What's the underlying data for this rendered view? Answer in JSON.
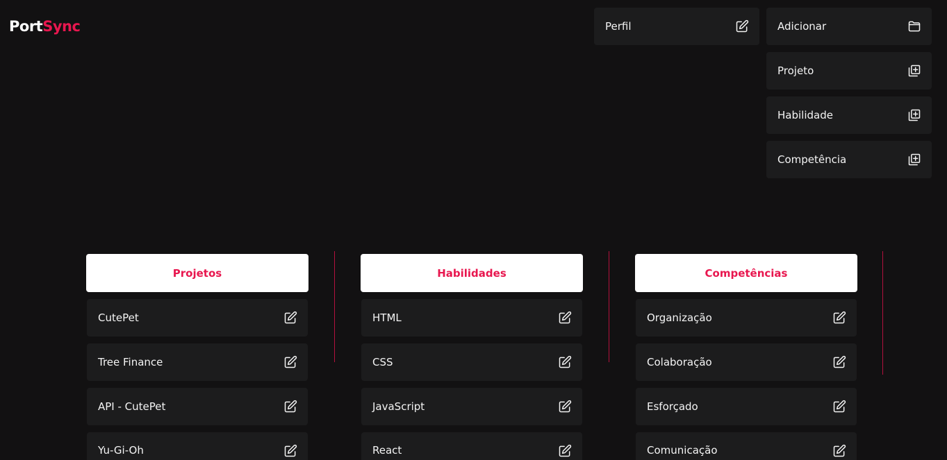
{
  "logo": {
    "part1": "Port",
    "part2": "Sync"
  },
  "profile": {
    "label": "Perfil",
    "icon": "edit-icon"
  },
  "add_menu": {
    "header": {
      "label": "Adicionar",
      "icon": "folder-icon"
    },
    "items": [
      {
        "label": "Projeto",
        "icon": "add-box-icon"
      },
      {
        "label": "Habilidade",
        "icon": "add-box-icon"
      },
      {
        "label": "Competência",
        "icon": "add-box-icon"
      }
    ]
  },
  "columns": [
    {
      "title": "Projetos",
      "items": [
        "CutePet",
        "Tree Finance",
        "API - CutePet",
        "Yu-Gi-Oh"
      ]
    },
    {
      "title": "Habilidades",
      "items": [
        "HTML",
        "CSS",
        "JavaScript",
        "React"
      ]
    },
    {
      "title": "Competências",
      "items": [
        "Organização",
        "Colaboração",
        "Esforçado",
        "Comunicação"
      ]
    }
  ],
  "colors": {
    "background": "#121112",
    "card": "#1c1c1d",
    "accent": "#e8174f",
    "text": "#f4f4f4"
  }
}
